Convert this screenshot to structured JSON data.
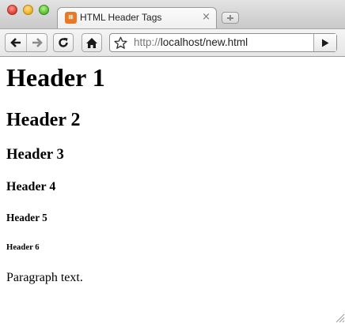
{
  "tab": {
    "favicon_glyph": "⌗",
    "title": "HTML Header Tags",
    "close_glyph": "×"
  },
  "toolbar": {
    "icons": [
      "back-arrow-icon",
      "forward-arrow-icon",
      "reload-icon",
      "home-icon",
      "star-icon",
      "go-arrow-icon"
    ]
  },
  "address_bar": {
    "scheme": "http://",
    "host_path": "localhost/new.html"
  },
  "page": {
    "headers": [
      "Header 1",
      "Header 2",
      "Header 3",
      "Header 4",
      "Header 5",
      "Header 6"
    ],
    "paragraph": "Paragraph text."
  },
  "colors": {
    "favicon": "#e87924",
    "close_light": "#e0443a",
    "minimize_light": "#f0b52d",
    "maximize_light": "#5fc53a"
  }
}
